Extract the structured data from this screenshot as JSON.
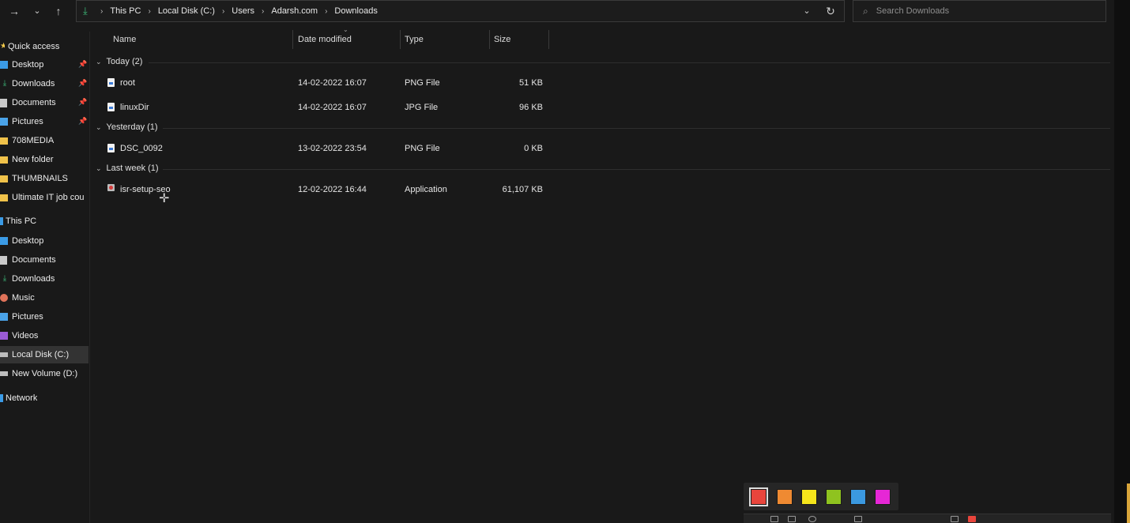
{
  "address": {
    "crumbs": [
      "This PC",
      "Local Disk (C:)",
      "Users",
      "Adarsh.com",
      "Downloads"
    ]
  },
  "search": {
    "placeholder": "Search Downloads"
  },
  "sidebar": {
    "quick_access": "Quick access",
    "quick_items": [
      {
        "label": "Desktop",
        "pinned": true
      },
      {
        "label": "Downloads",
        "pinned": true
      },
      {
        "label": "Documents",
        "pinned": true
      },
      {
        "label": "Pictures",
        "pinned": true
      },
      {
        "label": "708MEDIA"
      },
      {
        "label": "New folder"
      },
      {
        "label": "THUMBNAILS"
      },
      {
        "label": "Ultimate IT job cou"
      }
    ],
    "this_pc": "This PC",
    "pc_items": [
      "Desktop",
      "Documents",
      "Downloads",
      "Music",
      "Pictures",
      "Videos",
      "Local Disk (C:)",
      "New Volume (D:)"
    ],
    "network": "Network"
  },
  "columns": {
    "name": "Name",
    "date": "Date modified",
    "type": "Type",
    "size": "Size"
  },
  "groups": [
    {
      "label": "Today (2)",
      "files": [
        {
          "name": "root",
          "date": "14-02-2022 16:07",
          "type": "PNG File",
          "size": "51 KB"
        },
        {
          "name": "linuxDir",
          "date": "14-02-2022 16:07",
          "type": "JPG File",
          "size": "96 KB"
        }
      ]
    },
    {
      "label": "Yesterday (1)",
      "files": [
        {
          "name": "DSC_0092",
          "date": "13-02-2022 23:54",
          "type": "PNG File",
          "size": "0 KB"
        }
      ]
    },
    {
      "label": "Last week (1)",
      "files": [
        {
          "name": "isr-setup-seo",
          "date": "12-02-2022 16:44",
          "type": "Application",
          "size": "61,107 KB"
        }
      ]
    }
  ],
  "palette": {
    "colors": [
      "#e8453c",
      "#ef8a32",
      "#f5e51b",
      "#8fc31f",
      "#3b99e0",
      "#e627d6"
    ],
    "selected_index": 0
  }
}
